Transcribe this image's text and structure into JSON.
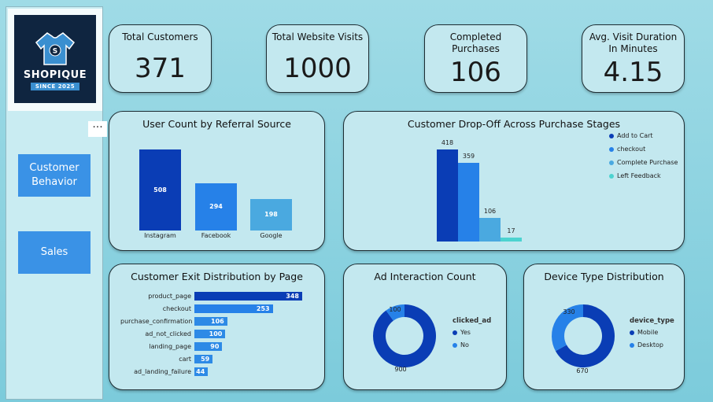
{
  "sidebar": {
    "logo_text": "SHOPIQUE",
    "logo_sub": "SINCE 2025",
    "more_label": "···",
    "nav": [
      {
        "label": "Customer Behavior"
      },
      {
        "label": "Sales"
      }
    ]
  },
  "kpis": [
    {
      "title": "Total Customers",
      "value": "371"
    },
    {
      "title": "Total Website Visits",
      "value": "1000"
    },
    {
      "title": "Completed Purchases",
      "value": "106"
    },
    {
      "title": "Avg. Visit Duration In Minutes",
      "value": "4.15"
    }
  ],
  "colors": {
    "dark_blue": "#0a3db5",
    "mid_blue": "#2681e8",
    "light_blue": "#4aa9e0",
    "teal": "#4cd3d0",
    "card_bg": "#c3e8ef"
  },
  "charts": {
    "referral": {
      "title": "User Count by Referral Source",
      "chart_data": {
        "type": "bar",
        "categories": [
          "Instagram",
          "Facebook",
          "Google"
        ],
        "values": [
          508,
          294,
          198
        ]
      }
    },
    "dropoff": {
      "title": "Customer Drop-Off Across Purchase Stages",
      "chart_data": {
        "type": "bar",
        "series": [
          {
            "name": "Add to Cart",
            "values": [
              418
            ]
          },
          {
            "name": "checkout",
            "values": [
              359
            ]
          },
          {
            "name": "Complete Purchase",
            "values": [
              106
            ]
          },
          {
            "name": "Left Feedback",
            "values": [
              17
            ]
          }
        ]
      }
    },
    "exit": {
      "title": "Customer Exit Distribution by Page",
      "chart_data": {
        "type": "bar",
        "categories": [
          "product_page",
          "checkout",
          "purchase_confirmation",
          "ad_not_clicked",
          "landing_page",
          "cart",
          "ad_landing_failure"
        ],
        "values": [
          348,
          253,
          106,
          100,
          90,
          59,
          44
        ]
      }
    },
    "ad": {
      "title": "Ad Interaction Count",
      "legend_title": "clicked_ad",
      "chart_data": {
        "type": "pie",
        "categories": [
          "Yes",
          "No"
        ],
        "values": [
          900,
          100
        ]
      }
    },
    "device": {
      "title": "Device Type Distribution",
      "legend_title": "device_type",
      "chart_data": {
        "type": "pie",
        "categories": [
          "Mobile",
          "Desktop"
        ],
        "values": [
          670,
          330
        ]
      }
    }
  }
}
